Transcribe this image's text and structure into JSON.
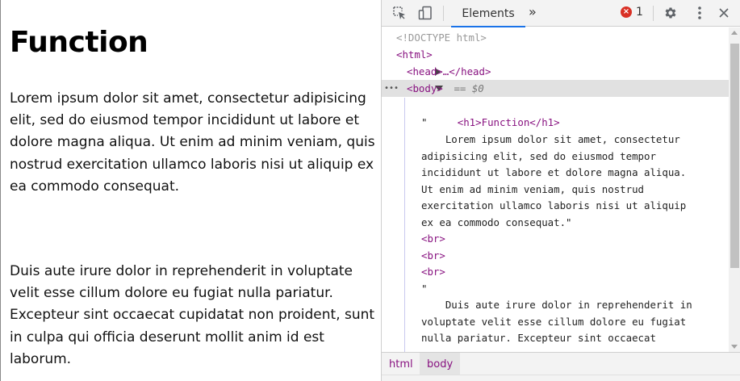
{
  "page": {
    "heading": "Function",
    "paragraph1": "Lorem ipsum dolor sit amet, consectetur adipisicing elit, sed do eiusmod tempor incididunt ut labore et dolore magna aliqua. Ut enim ad minim veniam, quis nostrud exercitation ullamco laboris nisi ut aliquip ex ea commodo consequat.",
    "paragraph2": "Duis aute irure dolor in reprehenderit in voluptate velit esse cillum dolore eu fugiat nulla pariatur. Excepteur sint occaecat cupidatat non proident, sunt in culpa qui officia deserunt mollit anim id est laborum."
  },
  "devtools": {
    "tabs": {
      "elements": "Elements",
      "more": "»"
    },
    "error_count": "1",
    "error_symbol": "×",
    "icons": {
      "inspect": "inspect-element-icon",
      "device": "device-toolbar-icon",
      "settings": "gear-icon",
      "menu": "kebab-menu-icon",
      "close": "close-icon"
    },
    "tree": {
      "doctype": "<!DOCTYPE html>",
      "html_open": "<html>",
      "head_collapsed": "<head>…</head>",
      "body_open": "<body>",
      "body_selected_marker": " == $0",
      "h1_line": "<h1>Function</h1>",
      "quote_open1": "\"",
      "text1_lines": [
        "    Lorem ipsum dolor sit amet, consectetur",
        "adipisicing elit, sed do eiusmod tempor",
        "incididunt ut labore et dolore magna aliqua.",
        "Ut enim ad minim veniam, quis nostrud",
        "exercitation ullamco laboris nisi ut aliquip",
        "ex ea commodo consequat.\""
      ],
      "br": "<br>",
      "quote_open2": "\"",
      "text2_lines": [
        "    Duis aute irure dolor in reprehenderit in",
        "voluptate velit esse cillum dolore eu fugiat",
        "nulla pariatur. Excepteur sint occaecat"
      ],
      "row_dots": "•••"
    },
    "breadcrumb": [
      "html",
      "body"
    ],
    "colors": {
      "accent": "#1a73e8",
      "tag": "#881280",
      "error": "#d93025"
    }
  }
}
